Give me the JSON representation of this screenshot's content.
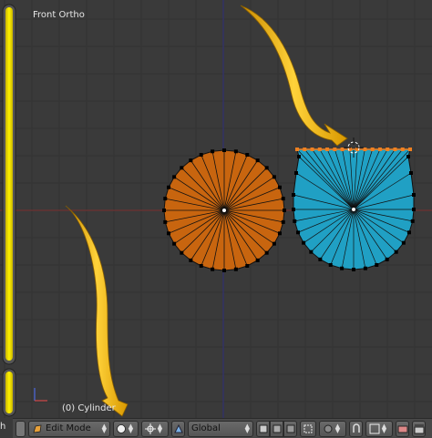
{
  "viewport": {
    "view_title": "Front Ortho",
    "object_label": "(0) Cylinder",
    "left_edge_text": "h"
  },
  "header": {
    "mode_label": "Edit Mode",
    "orientation_label": "Global"
  },
  "colors": {
    "background": "#393939",
    "left_disk": "#c8650f",
    "right_disk": "#20a0c4",
    "arrow": "#f6b800",
    "axis_red": "#8a3333",
    "axis_blue": "#3a3a8a"
  },
  "icons": [
    "editmode-icon",
    "shading-solid-icon",
    "pivot-icon",
    "transform-orientation-icon",
    "view-layer-icons",
    "snap-icon",
    "render-icon"
  ]
}
